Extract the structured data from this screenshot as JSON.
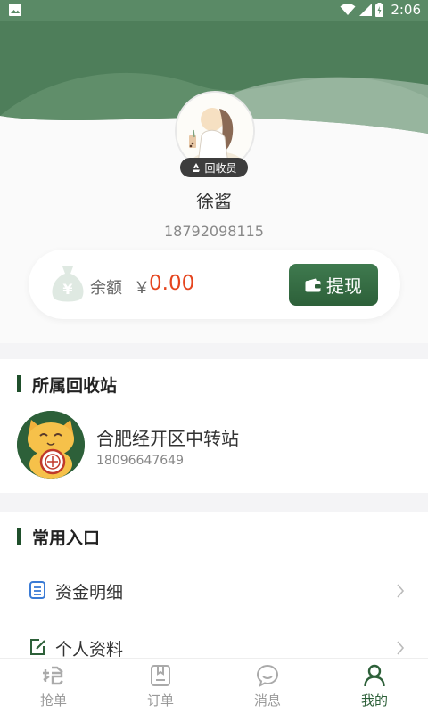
{
  "status_bar": {
    "time": "2:06"
  },
  "profile": {
    "role": "回收员",
    "name": "徐酱",
    "phone": "18792098115"
  },
  "balance": {
    "label": "余额",
    "currency": "￥",
    "value": "0.00",
    "withdraw_label": "提现"
  },
  "station_section": {
    "title": "所属回收站",
    "name": "合肥经开区中转站",
    "phone": "18096647649"
  },
  "common_section": {
    "title": "常用入口",
    "items": [
      {
        "label": "资金明细",
        "icon": "document-list-icon"
      },
      {
        "label": "个人资料",
        "icon": "edit-icon"
      }
    ]
  },
  "tabbar": {
    "items": [
      {
        "label": "抢单",
        "icon": "grab-icon",
        "active": false
      },
      {
        "label": "订单",
        "icon": "order-icon",
        "active": false
      },
      {
        "label": "消息",
        "icon": "message-icon",
        "active": false
      },
      {
        "label": "我的",
        "icon": "person-icon",
        "active": true
      }
    ]
  },
  "colors": {
    "primary": "#2d6039",
    "header_green": "#5a8a66",
    "balance_value": "#e5451f"
  }
}
